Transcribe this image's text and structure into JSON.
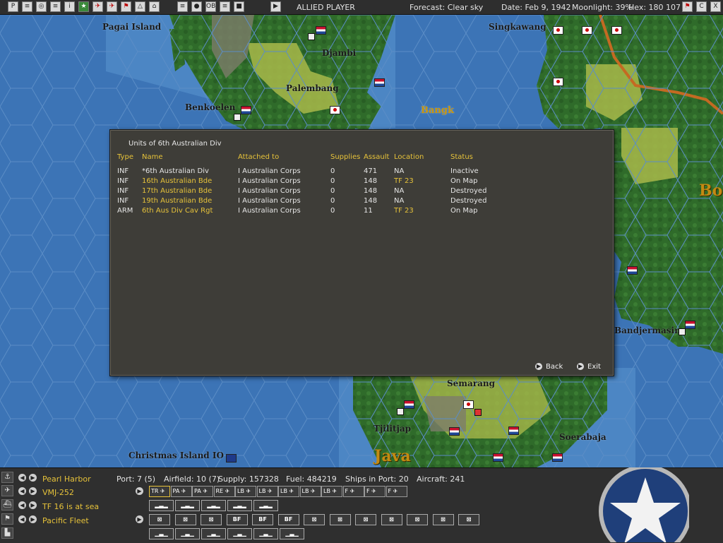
{
  "topbar": {
    "player": "ALLIED PLAYER",
    "forecast": "Forecast: Clear sky",
    "date": "Date: Feb 9, 1942",
    "moonlight": "Moonlight: 39%",
    "hex": "Hex: 180 107",
    "buttons": [
      "P",
      "≡",
      "◎",
      "≡",
      "i",
      "★",
      "✈",
      "✈",
      "⚑",
      "△",
      "⌂",
      "≡",
      "●",
      "OB",
      "≡",
      "■",
      "▶"
    ],
    "right_buttons": [
      "⚑",
      "C",
      "X"
    ]
  },
  "map": {
    "places": [
      "Pagai Island",
      "Djambi",
      "Palembang",
      "Benkoelen",
      "Singkawang",
      "Bangk",
      "Bo",
      "Bandjermasin",
      "Semarang",
      "Tjilitjap",
      "Soerabaja",
      "Christmas Island IO",
      "Java"
    ]
  },
  "dialog": {
    "title": "Units of 6th Australian Div",
    "headers": [
      "Type",
      "Name",
      "Attached to",
      "Supplies",
      "Assault",
      "Location",
      "Status"
    ],
    "rows": [
      {
        "type": "INF",
        "name": "*6th Australian Div",
        "attached": "I Australian Corps",
        "supplies": "0",
        "assault": "471",
        "location": "NA",
        "status": "Inactive",
        "highlight": false
      },
      {
        "type": "INF",
        "name": "16th Australian Bde",
        "attached": "I Australian Corps",
        "supplies": "0",
        "assault": "148",
        "location": "TF 23",
        "status": "On Map",
        "highlight": true
      },
      {
        "type": "INF",
        "name": "17th Australian Bde",
        "attached": "I Australian Corps",
        "supplies": "0",
        "assault": "148",
        "location": "NA",
        "status": "Destroyed",
        "highlight": true
      },
      {
        "type": "INF",
        "name": "19th Australian Bde",
        "attached": "I Australian Corps",
        "supplies": "0",
        "assault": "148",
        "location": "NA",
        "status": "Destroyed",
        "highlight": true
      },
      {
        "type": "ARM",
        "name": "6th Aus Div Cav Rgt",
        "attached": "I Australian Corps",
        "supplies": "0",
        "assault": "11",
        "location": "TF 23",
        "status": "On Map",
        "highlight": true
      }
    ],
    "back": "Back",
    "exit": "Exit"
  },
  "bottom": {
    "base": "Pearl Harbor",
    "air_unit": "VMJ-252",
    "task_force": "TF 16 is at sea",
    "hq": "Pacific Fleet",
    "port": "Port: 7 (5)",
    "airfield": "Airfield: 10 (7)",
    "supply": "Supply: 157328",
    "fuel": "Fuel: 484219",
    "ships_in_port": "Ships in Port: 20",
    "aircraft": "Aircraft: 241",
    "air_buttons": [
      "TR",
      "PA",
      "PA",
      "RE",
      "LB",
      "LB",
      "LB",
      "LB",
      "LB",
      "F",
      "F",
      "F"
    ],
    "ship_buttons": [
      "",
      "",
      "",
      "",
      ""
    ],
    "ground_buttons": [
      "",
      "",
      "",
      "BF",
      "BF",
      "BF",
      "",
      "",
      "",
      "",
      "",
      "",
      ""
    ],
    "misc_buttons": [
      "",
      "",
      "",
      "",
      "",
      ""
    ]
  },
  "colors": {
    "accent_yellow": "#e6c23a",
    "dialog_bg": "#3e3d38",
    "sea": "#3d76b8"
  }
}
